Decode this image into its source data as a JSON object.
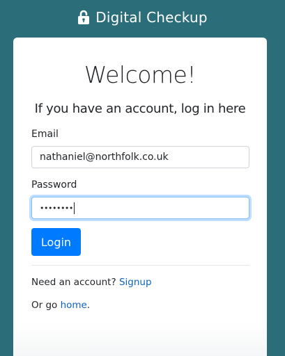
{
  "header": {
    "brand": "Digital Checkup",
    "icon": "unlock-icon"
  },
  "card": {
    "title": "Welcome!",
    "subtitle": "If you have an account, log in here",
    "email_label": "Email",
    "email_value": "nathaniel@northfolk.co.uk",
    "password_label": "Password",
    "password_value": "••••••••",
    "login_label": "Login",
    "signup_prefix": "Need an account?",
    "signup_link": "Signup",
    "home_prefix": "Or go",
    "home_link": "home",
    "home_suffix": "."
  },
  "colors": {
    "background": "#2b6e79",
    "primary": "#007bff",
    "link": "#0b63c6"
  }
}
